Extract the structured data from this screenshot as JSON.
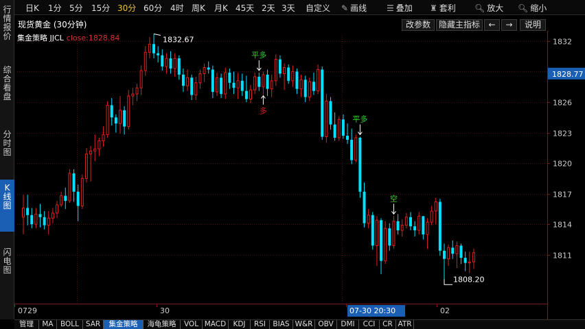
{
  "nav": {
    "items": [
      {
        "label": "行情报价"
      },
      {
        "label": "综合看盘"
      },
      {
        "label": "分时图"
      },
      {
        "label": "K线图"
      },
      {
        "label": "闪电图"
      }
    ]
  },
  "toolbar": {
    "periods": [
      "日K",
      "1分",
      "5分",
      "15分",
      "30分",
      "60分",
      "4时",
      "周K",
      "月K",
      "45天",
      "2天",
      "3天",
      "自定义"
    ],
    "active_period": "30分",
    "draw_label": "画线",
    "overlay_label": "叠加",
    "template_label": "套利",
    "zoom_in_label": "放大",
    "zoom_out_label": "缩小"
  },
  "header": {
    "title": "现货黄金 (30分钟)",
    "edit_params_label": "改参数",
    "hide_indicator_label": "隐藏主指标",
    "prev_label": "←",
    "next_label": "→",
    "help_label": "说明"
  },
  "indicator": {
    "name": "集金策略 JJCL",
    "close_label": "close:1828.84"
  },
  "chart_data": {
    "type": "candlestick",
    "y_axis_ticks": [
      1811.0,
      1814.0,
      1817.0,
      1820.0,
      1823.0,
      1826.0,
      1829.0,
      1832.0
    ],
    "ylim": [
      1806.2,
      1832.6
    ],
    "current_price_label": "1828.77",
    "x_axis_labels": [
      "0729",
      "30",
      "07-30 20:30",
      "02"
    ],
    "high_label": "1832.67",
    "low_label": "1808.20",
    "signals": [
      {
        "text": "平多",
        "color": "#31d431"
      },
      {
        "text": "多",
        "color": "#e02020"
      },
      {
        "text": "平多",
        "color": "#31d431"
      },
      {
        "text": "空",
        "color": "#31d431"
      }
    ],
    "candles": [
      {
        "o": 1814.7,
        "h": 1816.9,
        "l": 1813.0,
        "c": 1815.6
      },
      {
        "o": 1815.6,
        "h": 1816.9,
        "l": 1813.9,
        "c": 1814.9
      },
      {
        "o": 1814.9,
        "h": 1815.6,
        "l": 1813.6,
        "c": 1814.0
      },
      {
        "o": 1814.0,
        "h": 1815.6,
        "l": 1813.6,
        "c": 1815.0
      },
      {
        "o": 1815.0,
        "h": 1816.0,
        "l": 1813.7,
        "c": 1814.7
      },
      {
        "o": 1814.7,
        "h": 1815.3,
        "l": 1813.5,
        "c": 1813.9
      },
      {
        "o": 1813.9,
        "h": 1815.3,
        "l": 1813.0,
        "c": 1814.6
      },
      {
        "o": 1814.6,
        "h": 1815.6,
        "l": 1814.1,
        "c": 1815.1
      },
      {
        "o": 1815.1,
        "h": 1816.3,
        "l": 1814.6,
        "c": 1815.9
      },
      {
        "o": 1815.9,
        "h": 1817.2,
        "l": 1815.7,
        "c": 1816.8
      },
      {
        "o": 1816.8,
        "h": 1817.6,
        "l": 1815.5,
        "c": 1816.3
      },
      {
        "o": 1816.3,
        "h": 1819.4,
        "l": 1816.1,
        "c": 1819.0
      },
      {
        "o": 1819.0,
        "h": 1819.4,
        "l": 1816.2,
        "c": 1817.2
      },
      {
        "o": 1817.2,
        "h": 1817.9,
        "l": 1814.3,
        "c": 1815.8
      },
      {
        "o": 1815.8,
        "h": 1818.9,
        "l": 1815.5,
        "c": 1818.5
      },
      {
        "o": 1818.5,
        "h": 1821.5,
        "l": 1818.1,
        "c": 1820.9
      },
      {
        "o": 1820.9,
        "h": 1821.7,
        "l": 1818.2,
        "c": 1821.2
      },
      {
        "o": 1821.2,
        "h": 1822.8,
        "l": 1820.2,
        "c": 1821.4
      },
      {
        "o": 1821.4,
        "h": 1822.5,
        "l": 1820.7,
        "c": 1822.2
      },
      {
        "o": 1822.2,
        "h": 1823.6,
        "l": 1821.6,
        "c": 1822.8
      },
      {
        "o": 1822.8,
        "h": 1826.1,
        "l": 1822.5,
        "c": 1825.7
      },
      {
        "o": 1825.7,
        "h": 1826.4,
        "l": 1823.7,
        "c": 1824.5
      },
      {
        "o": 1824.5,
        "h": 1824.8,
        "l": 1823.0,
        "c": 1823.9
      },
      {
        "o": 1823.9,
        "h": 1826.6,
        "l": 1822.9,
        "c": 1825.2
      },
      {
        "o": 1825.2,
        "h": 1825.6,
        "l": 1822.8,
        "c": 1823.6
      },
      {
        "o": 1823.6,
        "h": 1827.2,
        "l": 1823.3,
        "c": 1826.6
      },
      {
        "o": 1826.6,
        "h": 1827.4,
        "l": 1825.7,
        "c": 1826.8
      },
      {
        "o": 1826.8,
        "h": 1827.8,
        "l": 1826.1,
        "c": 1827.4
      },
      {
        "o": 1827.4,
        "h": 1829.6,
        "l": 1826.7,
        "c": 1829.1
      },
      {
        "o": 1829.1,
        "h": 1831.5,
        "l": 1828.6,
        "c": 1830.9
      },
      {
        "o": 1830.9,
        "h": 1832.4,
        "l": 1830.3,
        "c": 1831.7
      },
      {
        "o": 1831.7,
        "h": 1832.7,
        "l": 1830.3,
        "c": 1830.8
      },
      {
        "o": 1830.8,
        "h": 1831.5,
        "l": 1829.9,
        "c": 1830.6
      },
      {
        "o": 1830.6,
        "h": 1831.2,
        "l": 1829.1,
        "c": 1829.5
      },
      {
        "o": 1829.5,
        "h": 1830.8,
        "l": 1828.8,
        "c": 1830.3
      },
      {
        "o": 1830.3,
        "h": 1831.0,
        "l": 1828.8,
        "c": 1829.3
      },
      {
        "o": 1829.3,
        "h": 1830.8,
        "l": 1828.5,
        "c": 1830.3
      },
      {
        "o": 1830.3,
        "h": 1830.6,
        "l": 1828.2,
        "c": 1828.7
      },
      {
        "o": 1828.7,
        "h": 1829.3,
        "l": 1827.0,
        "c": 1827.6
      },
      {
        "o": 1827.6,
        "h": 1829.2,
        "l": 1827.1,
        "c": 1828.4
      },
      {
        "o": 1828.4,
        "h": 1828.7,
        "l": 1826.2,
        "c": 1826.7
      },
      {
        "o": 1826.7,
        "h": 1828.5,
        "l": 1826.2,
        "c": 1827.9
      },
      {
        "o": 1827.9,
        "h": 1829.2,
        "l": 1827.3,
        "c": 1828.8
      },
      {
        "o": 1828.8,
        "h": 1829.8,
        "l": 1828.0,
        "c": 1829.4
      },
      {
        "o": 1829.4,
        "h": 1830.0,
        "l": 1828.8,
        "c": 1829.2
      },
      {
        "o": 1829.2,
        "h": 1829.6,
        "l": 1826.4,
        "c": 1827.0
      },
      {
        "o": 1827.0,
        "h": 1828.9,
        "l": 1826.6,
        "c": 1828.4
      },
      {
        "o": 1828.4,
        "h": 1828.8,
        "l": 1826.4,
        "c": 1826.8
      },
      {
        "o": 1826.8,
        "h": 1829.4,
        "l": 1826.3,
        "c": 1828.9
      },
      {
        "o": 1828.9,
        "h": 1829.3,
        "l": 1827.3,
        "c": 1827.9
      },
      {
        "o": 1827.9,
        "h": 1829.0,
        "l": 1826.8,
        "c": 1827.4
      },
      {
        "o": 1827.4,
        "h": 1828.9,
        "l": 1826.3,
        "c": 1828.1
      },
      {
        "o": 1828.1,
        "h": 1828.8,
        "l": 1826.6,
        "c": 1827.1
      },
      {
        "o": 1827.1,
        "h": 1828.6,
        "l": 1826.0,
        "c": 1826.3
      },
      {
        "o": 1826.3,
        "h": 1827.7,
        "l": 1825.9,
        "c": 1827.2
      },
      {
        "o": 1827.2,
        "h": 1828.9,
        "l": 1826.8,
        "c": 1828.5
      },
      {
        "o": 1828.5,
        "h": 1828.9,
        "l": 1827.1,
        "c": 1827.5
      },
      {
        "o": 1827.5,
        "h": 1829.0,
        "l": 1826.7,
        "c": 1828.7
      },
      {
        "o": 1828.7,
        "h": 1829.2,
        "l": 1826.6,
        "c": 1827.3
      },
      {
        "o": 1827.3,
        "h": 1828.7,
        "l": 1826.5,
        "c": 1828.1
      },
      {
        "o": 1828.1,
        "h": 1830.7,
        "l": 1827.6,
        "c": 1830.2
      },
      {
        "o": 1830.2,
        "h": 1830.6,
        "l": 1828.4,
        "c": 1828.8
      },
      {
        "o": 1828.8,
        "h": 1829.8,
        "l": 1827.2,
        "c": 1829.4
      },
      {
        "o": 1829.4,
        "h": 1829.7,
        "l": 1827.8,
        "c": 1828.1
      },
      {
        "o": 1828.1,
        "h": 1829.6,
        "l": 1827.5,
        "c": 1829.0
      },
      {
        "o": 1829.0,
        "h": 1829.3,
        "l": 1826.8,
        "c": 1827.3
      },
      {
        "o": 1827.3,
        "h": 1828.7,
        "l": 1826.5,
        "c": 1828.2
      },
      {
        "o": 1828.2,
        "h": 1828.6,
        "l": 1826.0,
        "c": 1826.5
      },
      {
        "o": 1826.5,
        "h": 1828.4,
        "l": 1826.1,
        "c": 1828.0
      },
      {
        "o": 1828.0,
        "h": 1828.9,
        "l": 1826.7,
        "c": 1827.1
      },
      {
        "o": 1827.1,
        "h": 1829.7,
        "l": 1826.8,
        "c": 1829.2
      },
      {
        "o": 1829.2,
        "h": 1829.5,
        "l": 1822.3,
        "c": 1822.6
      },
      {
        "o": 1822.6,
        "h": 1826.8,
        "l": 1822.0,
        "c": 1826.1
      },
      {
        "o": 1826.1,
        "h": 1826.5,
        "l": 1823.3,
        "c": 1823.8
      },
      {
        "o": 1823.8,
        "h": 1825.0,
        "l": 1822.2,
        "c": 1822.5
      },
      {
        "o": 1822.5,
        "h": 1824.6,
        "l": 1822.2,
        "c": 1824.3
      },
      {
        "o": 1824.3,
        "h": 1824.8,
        "l": 1822.4,
        "c": 1822.7
      },
      {
        "o": 1822.7,
        "h": 1823.9,
        "l": 1821.9,
        "c": 1822.3
      },
      {
        "o": 1822.3,
        "h": 1823.4,
        "l": 1819.9,
        "c": 1820.3
      },
      {
        "o": 1820.3,
        "h": 1822.8,
        "l": 1820.1,
        "c": 1822.5
      },
      {
        "o": 1822.5,
        "h": 1822.6,
        "l": 1816.6,
        "c": 1817.2
      },
      {
        "o": 1817.2,
        "h": 1818.1,
        "l": 1813.7,
        "c": 1814.1
      },
      {
        "o": 1814.1,
        "h": 1815.5,
        "l": 1813.6,
        "c": 1814.9
      },
      {
        "o": 1814.9,
        "h": 1815.2,
        "l": 1811.5,
        "c": 1811.9
      },
      {
        "o": 1811.9,
        "h": 1814.8,
        "l": 1809.9,
        "c": 1814.4
      },
      {
        "o": 1814.4,
        "h": 1814.6,
        "l": 1809.1,
        "c": 1810.4
      },
      {
        "o": 1810.4,
        "h": 1814.3,
        "l": 1810.1,
        "c": 1813.6
      },
      {
        "o": 1813.6,
        "h": 1814.1,
        "l": 1811.4,
        "c": 1811.9
      },
      {
        "o": 1811.9,
        "h": 1814.8,
        "l": 1811.6,
        "c": 1814.3
      },
      {
        "o": 1814.3,
        "h": 1815.0,
        "l": 1813.0,
        "c": 1813.4
      },
      {
        "o": 1813.4,
        "h": 1814.5,
        "l": 1812.8,
        "c": 1813.9
      },
      {
        "o": 1813.9,
        "h": 1815.1,
        "l": 1813.6,
        "c": 1814.7
      },
      {
        "o": 1814.7,
        "h": 1815.2,
        "l": 1813.4,
        "c": 1813.8
      },
      {
        "o": 1813.8,
        "h": 1814.3,
        "l": 1812.8,
        "c": 1813.4
      },
      {
        "o": 1813.4,
        "h": 1815.2,
        "l": 1813.0,
        "c": 1814.8
      },
      {
        "o": 1814.8,
        "h": 1814.8,
        "l": 1812.5,
        "c": 1813.0
      },
      {
        "o": 1813.0,
        "h": 1814.6,
        "l": 1811.6,
        "c": 1814.2
      },
      {
        "o": 1814.2,
        "h": 1815.8,
        "l": 1813.9,
        "c": 1815.3
      },
      {
        "o": 1815.3,
        "h": 1816.6,
        "l": 1814.0,
        "c": 1816.2
      },
      {
        "o": 1816.2,
        "h": 1816.5,
        "l": 1810.9,
        "c": 1811.4
      },
      {
        "o": 1811.4,
        "h": 1812.1,
        "l": 1808.2,
        "c": 1810.6
      },
      {
        "o": 1810.6,
        "h": 1812.0,
        "l": 1809.9,
        "c": 1811.7
      },
      {
        "o": 1811.7,
        "h": 1812.4,
        "l": 1810.6,
        "c": 1811.1
      },
      {
        "o": 1811.1,
        "h": 1812.3,
        "l": 1809.7,
        "c": 1811.9
      },
      {
        "o": 1811.9,
        "h": 1812.1,
        "l": 1810.1,
        "c": 1810.7
      },
      {
        "o": 1810.7,
        "h": 1811.3,
        "l": 1809.4,
        "c": 1810.2
      },
      {
        "o": 1810.2,
        "h": 1811.3,
        "l": 1809.2,
        "c": 1810.3
      },
      {
        "o": 1810.3,
        "h": 1811.6,
        "l": 1809.6,
        "c": 1811.2
      }
    ]
  },
  "bottom_tabs": [
    {
      "label": "管理",
      "active": false
    },
    {
      "label": "MA",
      "active": false
    },
    {
      "label": "BOLL",
      "active": false
    },
    {
      "label": "SAR",
      "active": false
    },
    {
      "label": "集金策略",
      "active": true
    },
    {
      "label": "海龟策略",
      "active": false
    },
    {
      "label": "VOL",
      "active": false
    },
    {
      "label": "MACD",
      "active": false
    },
    {
      "label": "KDJ",
      "active": false
    },
    {
      "label": "RSI",
      "active": false
    },
    {
      "label": "BIAS",
      "active": false
    },
    {
      "label": "W&R",
      "active": false
    },
    {
      "label": "OBV",
      "active": false
    },
    {
      "label": "DMI",
      "active": false
    },
    {
      "label": "CCI",
      "active": false
    },
    {
      "label": "CR",
      "active": false
    },
    {
      "label": "ATR",
      "active": false
    }
  ],
  "colors": {
    "up": "#e02020",
    "down": "#00e0ff",
    "grid": "#4a0f0f",
    "axis": "#7a1a1a",
    "highlight": "#1a5fb4"
  }
}
